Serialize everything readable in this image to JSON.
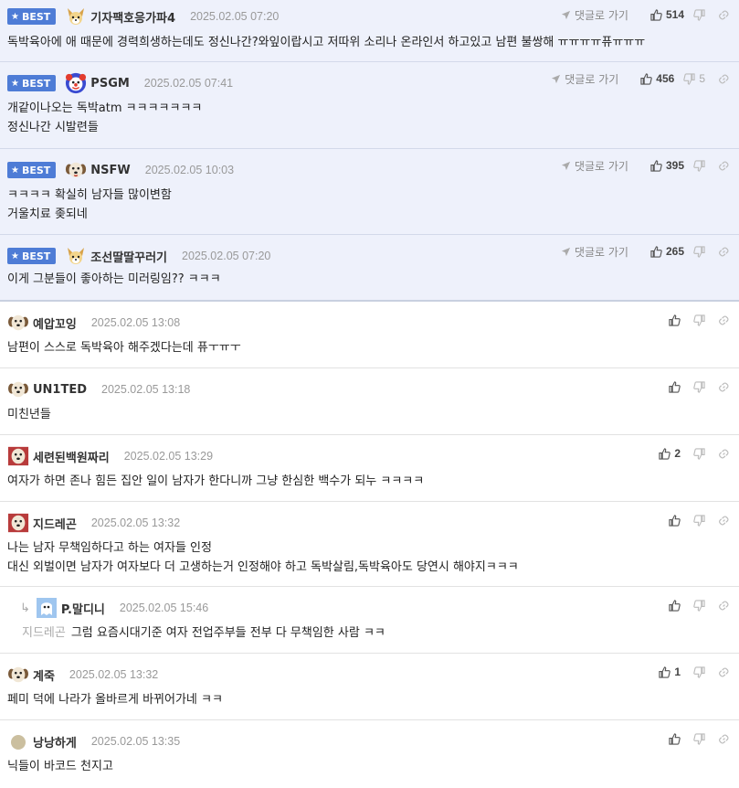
{
  "labels": {
    "best": "BEST",
    "goto": "댓글로 가기"
  },
  "colors": {
    "best_badge": "#4e7cd6",
    "best_background": "#eef1fb"
  },
  "comments": [
    {
      "best": true,
      "avatar": "dog-icon",
      "nick": "기자팩호응가파4",
      "date": "2025.02.05 07:20",
      "likes": "514",
      "dislikes": "",
      "lines": [
        "독박육아에 애 때문에 경력희생하는데도 정신나간?와잎이랍시고 저따위 소리나 온라인서 하고있고 남편 불쌍해 ㅠㅠㅠㅠ퓨ㅠㅠㅠ"
      ]
    },
    {
      "best": true,
      "avatar": "clown-icon",
      "nick": "PSGM",
      "date": "2025.02.05 07:41",
      "likes": "456",
      "dislikes": "5",
      "lines": [
        "개같이나오는 독박atm ㅋㅋㅋㅋㅋㅋㅋ",
        "정신나간 시발련들"
      ]
    },
    {
      "best": true,
      "avatar": "puppy-icon",
      "nick": "NSFW",
      "date": "2025.02.05 10:03",
      "likes": "395",
      "dislikes": "",
      "lines": [
        "ㅋㅋㅋㅋ 확실히 남자들 많이변함",
        "거울치료 좆되네"
      ]
    },
    {
      "best": true,
      "avatar": "dog-icon",
      "nick": "조선딸딸꾸러기",
      "date": "2025.02.05 07:20",
      "likes": "265",
      "dislikes": "",
      "lines": [
        "이게 그분들이 좋아하는 미러링임?? ㅋㅋㅋ"
      ]
    },
    {
      "best": false,
      "avatar": "puppy-icon",
      "nick": "예압꼬잉",
      "date": "2025.02.05 13:08",
      "likes": "",
      "dislikes": "",
      "lines": [
        "남편이 스스로 독박육아 해주겠다는데 퓨ㅜㅠㅜ"
      ]
    },
    {
      "best": false,
      "avatar": "puppy-icon",
      "nick": "UN1TED",
      "date": "2025.02.05 13:18",
      "likes": "",
      "dislikes": "",
      "lines": [
        "미친년들"
      ]
    },
    {
      "best": false,
      "avatar": "puppy-red-icon",
      "nick": "세련된백원짜리",
      "date": "2025.02.05 13:29",
      "likes": "2",
      "dislikes": "",
      "lines": [
        "여자가 하면 존나 힘든 집안 일이 남자가 한다니까 그냥 한심한 백수가 되누 ㅋㅋㅋㅋ"
      ]
    },
    {
      "best": false,
      "avatar": "puppy-red-icon",
      "nick": "지드레곤",
      "date": "2025.02.05 13:32",
      "likes": "",
      "dislikes": "",
      "lines": [
        "나는 남자 무책임하다고 하는 여자들 인정",
        "대신 외벌이면 남자가 여자보다 더 고생하는거 인정해야 하고 독박살림,독박육아도 당연시 해야지ㅋㅋㅋ"
      ]
    },
    {
      "best": false,
      "reply": true,
      "avatar": "ghost-icon",
      "nick": "P.말디니",
      "date": "2025.02.05 15:46",
      "likes": "",
      "dislikes": "",
      "mention": "지드레곤",
      "lines": [
        "그럼 요즘시대기준 여자 전업주부들 전부 다 무책임한 사람 ㅋㅋ"
      ]
    },
    {
      "best": false,
      "avatar": "puppy-icon",
      "nick": "계죽",
      "date": "2025.02.05 13:32",
      "likes": "1",
      "dislikes": "",
      "lines": [
        "페미 덕에 나라가 올바르게 바뀌어가네 ㅋㅋ"
      ]
    },
    {
      "best": false,
      "avatar": "circle-icon",
      "nick": "낭낭하게",
      "date": "2025.02.05 13:35",
      "likes": "",
      "dislikes": "",
      "lines": [
        "닉들이 바코드 천지고"
      ]
    }
  ]
}
